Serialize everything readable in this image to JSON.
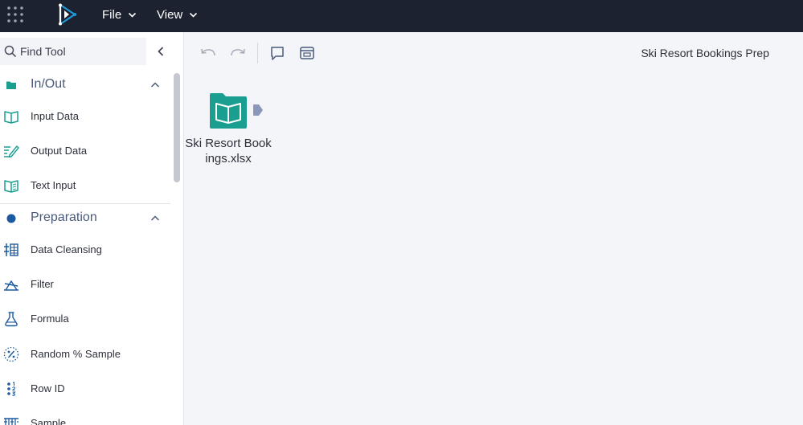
{
  "topbar": {
    "menus": [
      {
        "label": "File"
      },
      {
        "label": "View"
      }
    ]
  },
  "sidebar": {
    "search_placeholder": "Find Tool",
    "categories": [
      {
        "label": "In/Out",
        "color": "#1a9e8f",
        "tools": [
          {
            "label": "Input Data",
            "icon": "book-icon"
          },
          {
            "label": "Output Data",
            "icon": "pencil-lines-icon"
          },
          {
            "label": "Text Input",
            "icon": "book-grid-icon"
          }
        ]
      },
      {
        "label": "Preparation",
        "color": "#1b5aa0",
        "tools": [
          {
            "label": "Data Cleansing",
            "icon": "cleansing-icon"
          },
          {
            "label": "Filter",
            "icon": "filter-icon"
          },
          {
            "label": "Formula",
            "icon": "flask-icon"
          },
          {
            "label": "Random % Sample",
            "icon": "percent-icon"
          },
          {
            "label": "Row ID",
            "icon": "row-id-icon"
          },
          {
            "label": "Sample",
            "icon": "sample-icon"
          }
        ]
      }
    ]
  },
  "canvas": {
    "workflow_title": "Ski Resort Bookings Prep",
    "node": {
      "label": "Ski Resort Bookings.xlsx",
      "color": "#1a9e8f"
    }
  },
  "colors": {
    "topbar_bg": "#1d2230",
    "accent": "#1b9bd7",
    "io_green": "#1a9e8f",
    "prep_blue": "#1b5aa0"
  }
}
